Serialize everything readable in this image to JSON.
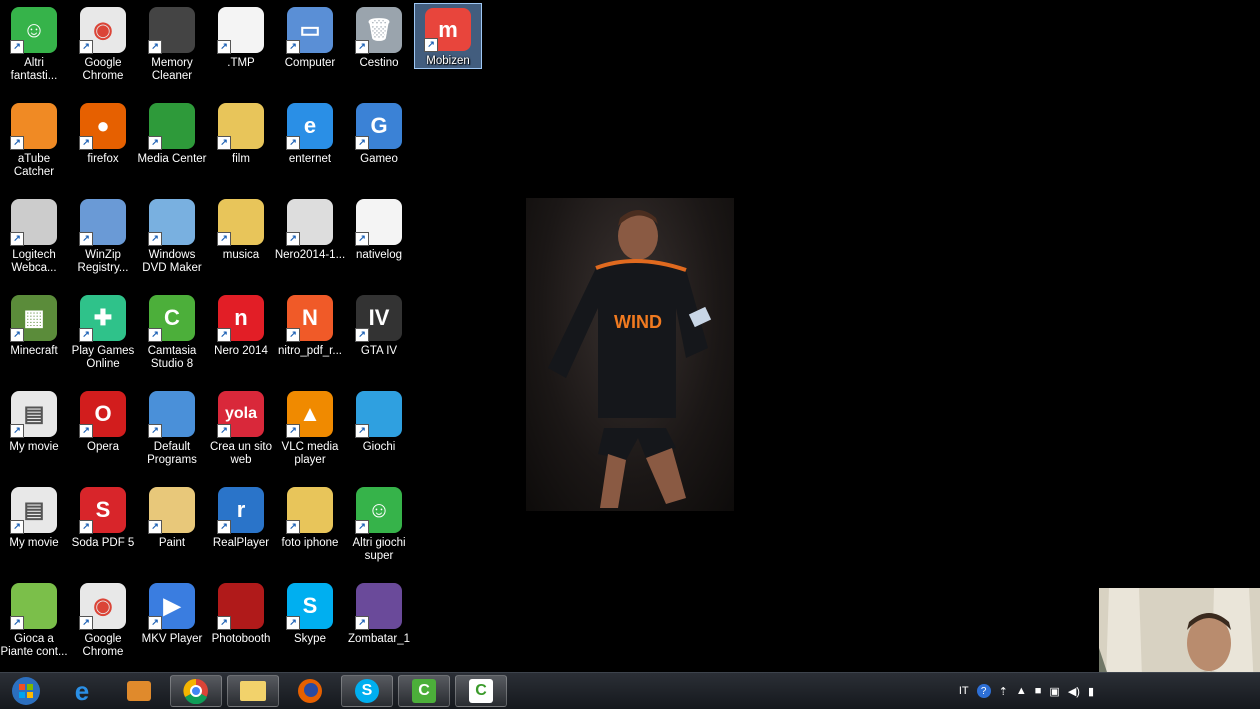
{
  "desktop": {
    "icons": [
      {
        "label": "Altri\nfantasti...",
        "icon": "game-icon"
      },
      {
        "label": "Google\nChrome",
        "icon": "chrome-icon"
      },
      {
        "label": "Memory\nCleaner",
        "icon": "memory-chip-icon"
      },
      {
        "label": ".TMP",
        "icon": "file-icon"
      },
      {
        "label": "Computer",
        "icon": "computer-icon"
      },
      {
        "label": "Cestino",
        "icon": "recycle-bin-icon"
      },
      {
        "label": "Mobizen",
        "icon": "mobizen-icon"
      },
      {
        "label": "aTube\nCatcher",
        "icon": "atube-icon"
      },
      {
        "label": "firefox",
        "icon": "firefox-icon"
      },
      {
        "label": "Media Center",
        "icon": "media-center-icon"
      },
      {
        "label": "film",
        "icon": "folder-icon"
      },
      {
        "label": "enternet",
        "icon": "ie-icon"
      },
      {
        "label": "Gameo",
        "icon": "gameo-icon"
      },
      {
        "label": "Logitech\nWebca...",
        "icon": "webcam-icon"
      },
      {
        "label": "WinZip\nRegistry...",
        "icon": "winzip-icon"
      },
      {
        "label": "Windows\nDVD Maker",
        "icon": "dvd-maker-icon"
      },
      {
        "label": "musica",
        "icon": "folder-icon"
      },
      {
        "label": "Nero2014-1...",
        "icon": "nero-installer-icon"
      },
      {
        "label": "nativelog",
        "icon": "file-icon"
      },
      {
        "label": "Minecraft",
        "icon": "minecraft-icon"
      },
      {
        "label": "Play Games\nOnline",
        "icon": "gamepad-icon"
      },
      {
        "label": "Camtasia\nStudio 8",
        "icon": "camtasia-icon"
      },
      {
        "label": "Nero 2014",
        "icon": "nero-icon"
      },
      {
        "label": "nitro_pdf_r...",
        "icon": "nitro-pdf-icon"
      },
      {
        "label": "GTA IV",
        "icon": "gta-icon"
      },
      {
        "label": "My movie",
        "icon": "movie-file-icon"
      },
      {
        "label": "Opera",
        "icon": "opera-icon"
      },
      {
        "label": "Default\nPrograms",
        "icon": "default-programs-icon"
      },
      {
        "label": "Crea un sito\nweb",
        "icon": "yola-icon"
      },
      {
        "label": "VLC media\nplayer",
        "icon": "vlc-icon"
      },
      {
        "label": "Giochi",
        "icon": "bigfish-icon"
      },
      {
        "label": "My movie",
        "icon": "movie-file-icon"
      },
      {
        "label": "Soda PDF 5",
        "icon": "soda-pdf-icon"
      },
      {
        "label": "Paint",
        "icon": "paint-icon"
      },
      {
        "label": "RealPlayer",
        "icon": "realplayer-icon"
      },
      {
        "label": "foto iphone",
        "icon": "folder-icon"
      },
      {
        "label": "Altri giochi\nsuper",
        "icon": "game-icon"
      },
      {
        "label": "Gioca a\nPiante cont...",
        "icon": "plants-zombies-icon"
      },
      {
        "label": "Google\nChrome",
        "icon": "chrome-icon"
      },
      {
        "label": "MKV Player",
        "icon": "mkv-player-icon"
      },
      {
        "label": "Photobooth",
        "icon": "photobooth-icon"
      },
      {
        "label": "Skype",
        "icon": "skype-icon"
      },
      {
        "label": "Zombatar_1",
        "icon": "zombatar-icon"
      }
    ],
    "photo_text": "WIND"
  },
  "taskbar": {
    "items": [
      {
        "icon": "start-orb-icon"
      },
      {
        "icon": "ie-icon"
      },
      {
        "icon": "toolbox-icon"
      },
      {
        "icon": "chrome-icon"
      },
      {
        "icon": "explorer-folder-icon"
      },
      {
        "icon": "firefox-icon"
      },
      {
        "icon": "skype-icon"
      },
      {
        "icon": "camtasia-icon"
      },
      {
        "icon": "camtasia-recorder-icon"
      }
    ],
    "tray": {
      "language": "IT"
    }
  },
  "colors": {
    "accent": "#3a7bd5",
    "taskbar": "#1b1f25"
  }
}
